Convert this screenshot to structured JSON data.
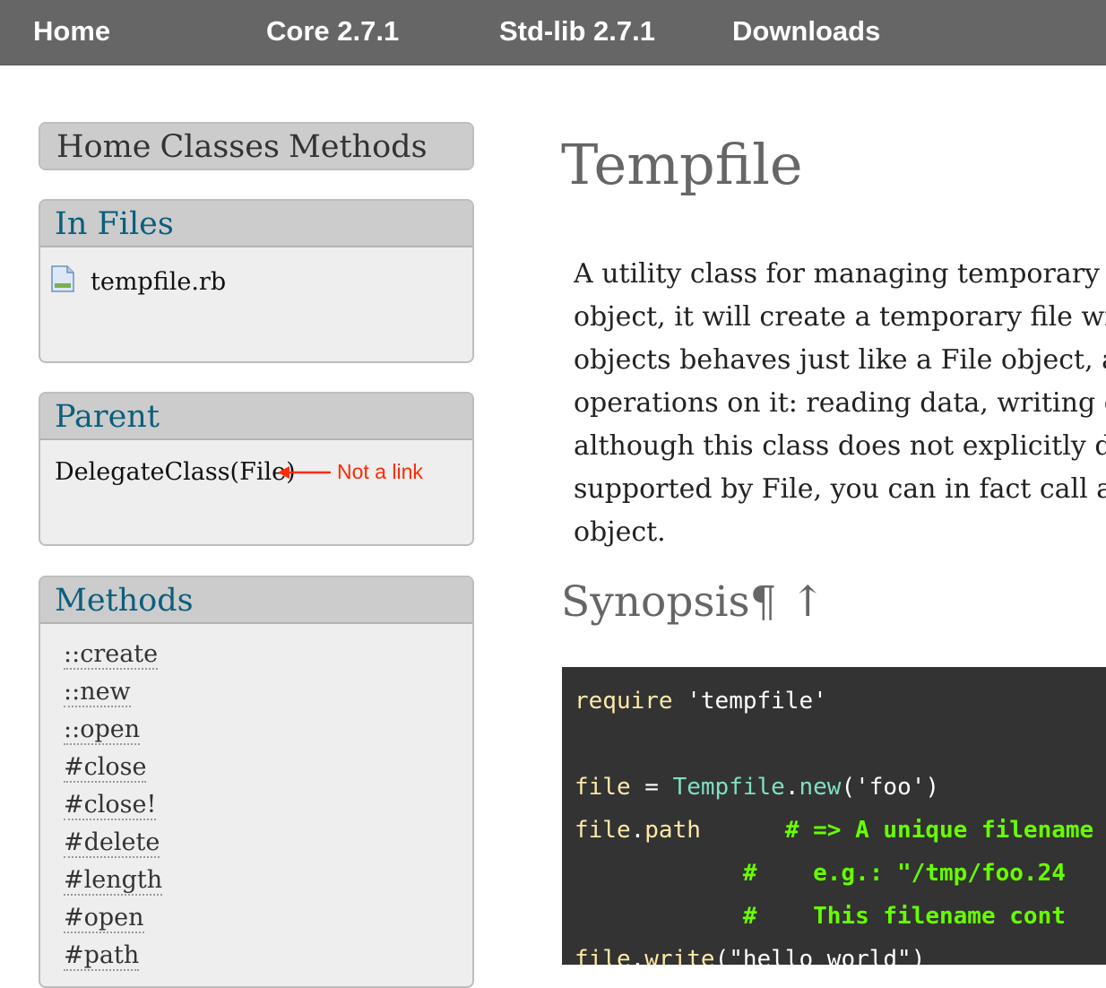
{
  "nav": {
    "home": "Home",
    "core": "Core 2.7.1",
    "stdlib": "Std-lib 2.7.1",
    "downloads": "Downloads"
  },
  "sidebar": {
    "top_links": [
      "Home",
      "Classes",
      "Methods"
    ],
    "in_files": {
      "title": "In Files",
      "file": "tempfile.rb"
    },
    "parent": {
      "title": "Parent",
      "value": "DelegateClass(File)",
      "annotation": "Not a link"
    },
    "methods": {
      "title": "Methods",
      "items": [
        "::create",
        "::new",
        "::open",
        "#close",
        "#close!",
        "#delete",
        "#length",
        "#open",
        "#path"
      ]
    }
  },
  "main": {
    "title": "Tempfile",
    "description_lines": [
      "A utility class for managing temporary files",
      "object, it will create a temporary file with a",
      "objects behaves just like a File object, and",
      "operations on it: reading data, writing data",
      "although this class does not explicitly docu",
      "supported by File, you can in fact call any F",
      "object."
    ],
    "synopsis": "Synopsis¶ ↑",
    "code": {
      "line1_kw": "require",
      "line1_str": " 'tempfile'",
      "line3_a": "file",
      "line3_b": " = ",
      "line3_cls": "Tempfile",
      "line3_dot": ".",
      "line3_mth": "new",
      "line3_rest": "('foo')",
      "line4_a": "file",
      "line4_dot": ".",
      "line4_mth": "path",
      "line4_pad": "      ",
      "line4_cmt": "# => A unique filename",
      "line5_cmt": "#    e.g.: \"/tmp/foo.24",
      "line6_cmt": "#    This filename cont",
      "line7_a": "file",
      "line7_dot": ".",
      "line7_mth": "write",
      "line7_rest": "(\"hello world\")"
    }
  },
  "colors": {
    "nav_bg": "#666666",
    "panel_head_link": "#0a5f7d",
    "annotation": "#ff2a00",
    "code_bg": "#333333",
    "code_comment": "#66ff00"
  }
}
